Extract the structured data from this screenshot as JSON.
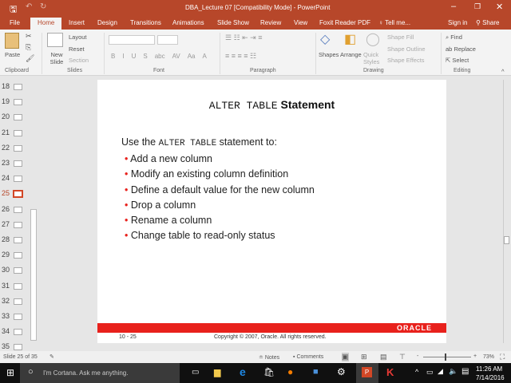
{
  "window": {
    "title": "DBA_Lecture 07 [Compatibility Mode] - PowerPoint"
  },
  "tabs": [
    "File",
    "Home",
    "Insert",
    "Design",
    "Transitions",
    "Animations",
    "Slide Show",
    "Review",
    "View",
    "Foxit Reader PDF",
    "Tell me..."
  ],
  "account": {
    "sign_in": "Sign in",
    "share": "Share"
  },
  "ribbon": {
    "clipboard": {
      "paste": "Paste",
      "label": "Clipboard"
    },
    "slides": {
      "new_slide": "New Slide",
      "layout": "Layout",
      "reset": "Reset",
      "section": "Section",
      "label": "Slides"
    },
    "font": {
      "label": "Font",
      "buttons": [
        "B",
        "I",
        "U",
        "S",
        "abc",
        "AV",
        "Aa",
        "A"
      ]
    },
    "paragraph": {
      "label": "Paragraph"
    },
    "drawing": {
      "shapes": "Shapes",
      "arrange": "Arrange",
      "quick_styles": "Quick Styles",
      "shape_fill": "Shape Fill",
      "shape_outline": "Shape Outline",
      "shape_effects": "Shape Effects",
      "label": "Drawing"
    },
    "editing": {
      "find": "Find",
      "replace": "Replace",
      "select": "Select",
      "label": "Editing"
    }
  },
  "thumbnails": [
    "18",
    "19",
    "20",
    "21",
    "22",
    "23",
    "24",
    "25",
    "26",
    "27",
    "28",
    "29",
    "30",
    "31",
    "32",
    "33",
    "34",
    "35"
  ],
  "current_slide": "25",
  "slide": {
    "title_code": "ALTER TABLE",
    "title_rest": " Statement",
    "intro_pre": "Use the ",
    "intro_code": "ALTER TABLE",
    "intro_post": " statement to:",
    "bullets": [
      "Add a new column",
      "Modify an existing column definition",
      "Define a default value for the new column",
      "Drop a column",
      "Rename a column",
      "Change table to read-only status"
    ],
    "brand": "ORACLE",
    "page": "10 - 25",
    "copyright": "Copyright © 2007, Oracle. All rights reserved."
  },
  "status": {
    "slide_of": "Slide 25 of 35",
    "notes": "Notes",
    "comments": "Comments",
    "zoom": "73%",
    "zoom_fraction": 0.45
  },
  "taskbar": {
    "cortana": "I'm Cortana. Ask me anything.",
    "time": "11:26 AM",
    "date": "7/14/2016"
  },
  "colors": {
    "accent": "#b7472a",
    "oracle_red": "#e8211c"
  }
}
